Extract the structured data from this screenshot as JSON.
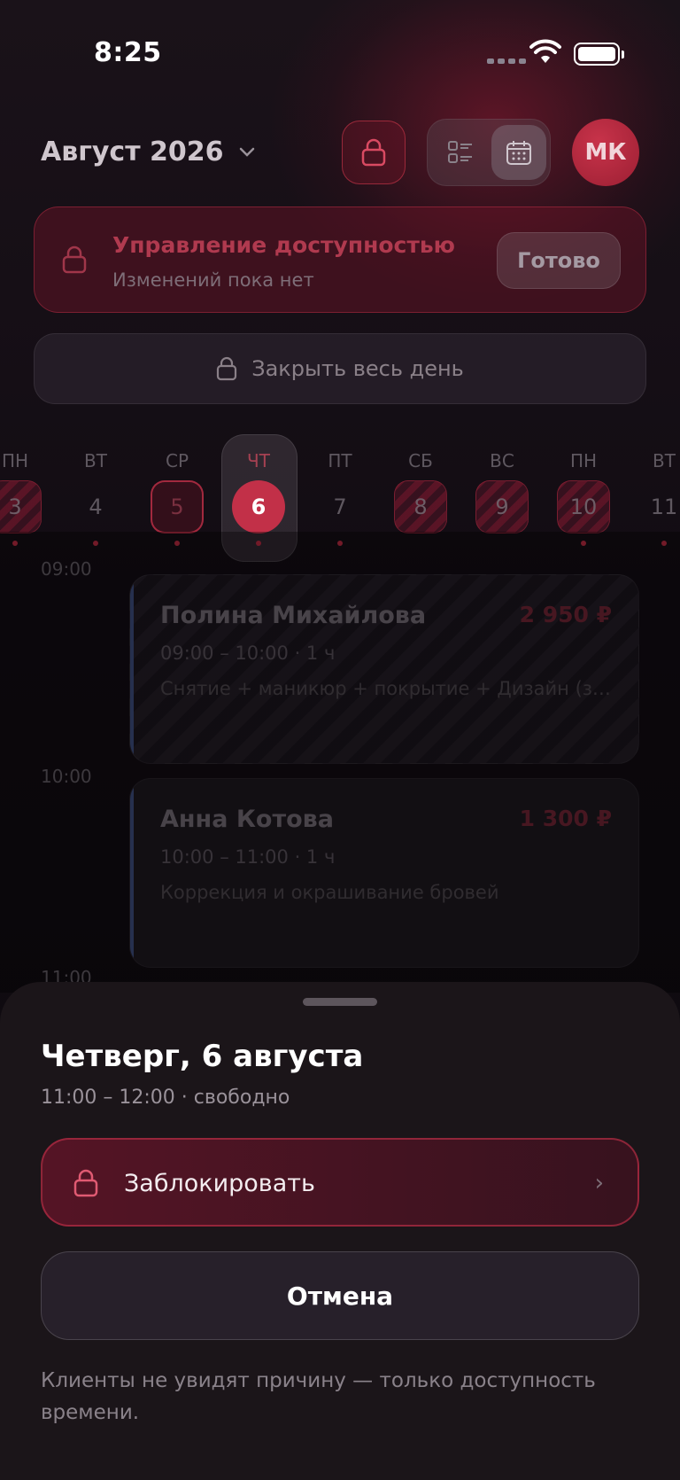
{
  "status_bar": {
    "time": "8:25"
  },
  "header": {
    "month": "Август 2026",
    "avatar_initials": "МК"
  },
  "availability": {
    "title": "Управление доступностью",
    "subtitle": "Изменений пока нет",
    "done_label": "Готово"
  },
  "close_day_label": "Закрыть весь день",
  "days": [
    {
      "dow": "ПН",
      "num": "3",
      "state": "blocked",
      "dot": true
    },
    {
      "dow": "ВТ",
      "num": "4",
      "state": "normal",
      "dot": true
    },
    {
      "dow": "СР",
      "num": "5",
      "state": "outlined",
      "dot": true
    },
    {
      "dow": "ЧТ",
      "num": "6",
      "state": "selected",
      "dot": true
    },
    {
      "dow": "ПТ",
      "num": "7",
      "state": "normal",
      "dot": true
    },
    {
      "dow": "СБ",
      "num": "8",
      "state": "blocked",
      "dot": false
    },
    {
      "dow": "ВС",
      "num": "9",
      "state": "blocked",
      "dot": false
    },
    {
      "dow": "ПН",
      "num": "10",
      "state": "blocked",
      "dot": true
    },
    {
      "dow": "ВТ",
      "num": "11",
      "state": "normal",
      "dot": true
    }
  ],
  "timeline": {
    "labels": [
      "09:00",
      "10:00",
      "11:00"
    ],
    "appointments": [
      {
        "name": "Полина Михайлова",
        "price": "2 950 ₽",
        "time": "09:00 – 10:00 · 1 ч",
        "service": "Снятие + маникюр + покрытие + Дизайн (за..."
      },
      {
        "name": "Анна Котова",
        "price": "1 300 ₽",
        "time": "10:00 – 11:00 · 1 ч",
        "service": "Коррекция и окрашивание бровей"
      }
    ]
  },
  "sheet": {
    "title": "Четверг, 6 августа",
    "subtitle": "11:00 – 12:00 · свободно",
    "block_label": "Заблокировать",
    "cancel_label": "Отмена",
    "note": "Клиенты не увидят причину — только доступность времени."
  },
  "colors": {
    "accent": "#c23048",
    "background": "#0e0a10",
    "sheet": "#1b1519"
  }
}
